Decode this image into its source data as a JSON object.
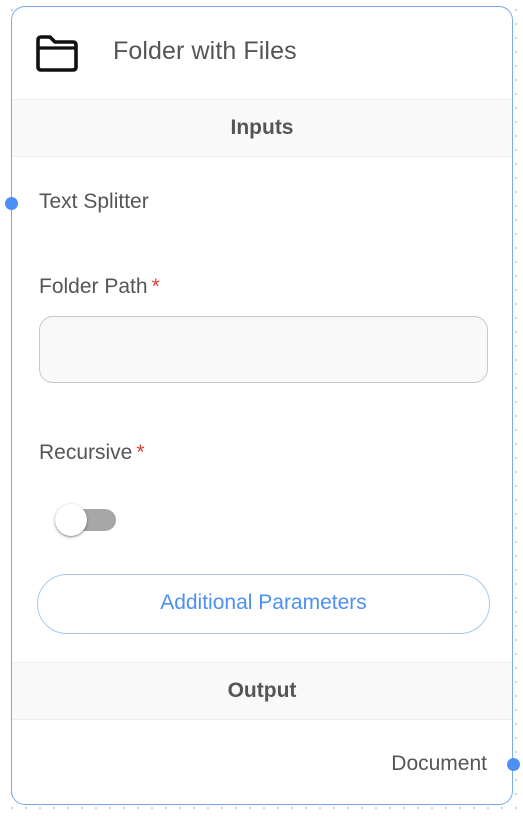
{
  "node": {
    "title": "Folder with Files",
    "icon": "folder-icon",
    "accent_color": "#4d8ff5",
    "border_color": "#79a8ec"
  },
  "inputs_section": {
    "title": "Inputs",
    "anchors": [
      {
        "label": "Text Splitter"
      }
    ],
    "params": {
      "folder_path": {
        "label": "Folder Path",
        "required_marker": "*",
        "value": "",
        "placeholder": ""
      },
      "recursive": {
        "label": "Recursive",
        "required_marker": "*",
        "checked": false
      }
    },
    "additional_parameters_label": "Additional Parameters"
  },
  "output_section": {
    "title": "Output",
    "anchors": [
      {
        "label": "Document"
      }
    ]
  }
}
